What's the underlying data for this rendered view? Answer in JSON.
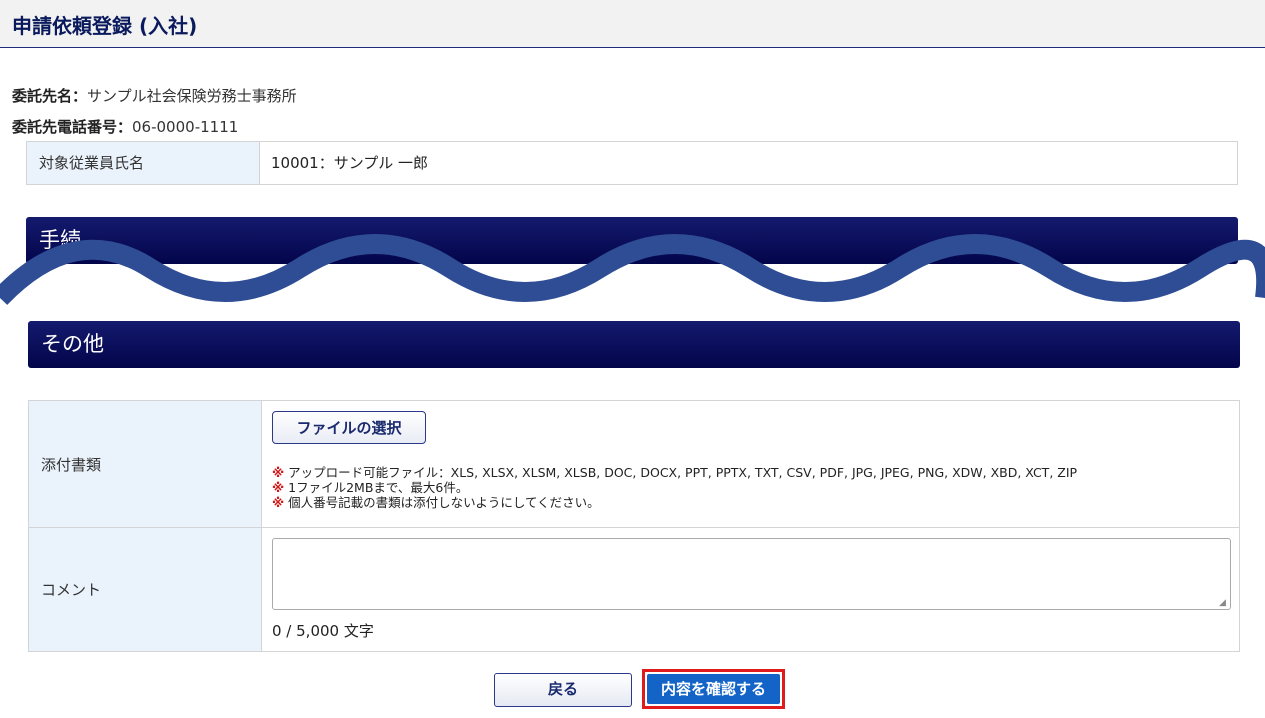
{
  "page": {
    "title": "申請依頼登録 (入社)"
  },
  "contractor": {
    "name_label": "委託先名：",
    "name_value": "サンプル社会保険労務士事務所",
    "phone_label": "委託先電話番号：",
    "phone_value": "06-0000-1111"
  },
  "employee": {
    "label": "対象従業員氏名",
    "value": "10001：サンプル 一郎"
  },
  "sections": {
    "procedure": "手続",
    "other": "その他"
  },
  "attachments": {
    "label": "添付書類",
    "file_button": "ファイルの選択",
    "mark": "※",
    "notes": [
      "アップロード可能ファイル：XLS, XLSX, XLSM, XLSB, DOC, DOCX, PPT, PPTX, TXT, CSV, PDF, JPG, JPEG, PNG, XDW, XBD, XCT, ZIP",
      "1ファイル2MBまで、最大6件。",
      "個人番号記載の書類は添付しないようにしてください。"
    ]
  },
  "comment": {
    "label": "コメント",
    "value": "",
    "counter": "0 / 5,000 文字"
  },
  "actions": {
    "back": "戻る",
    "confirm": "内容を確認する"
  },
  "colors": {
    "section_bar": "#0b0f5e",
    "wave": "#2e4d94",
    "confirm": "#1464c8",
    "highlight": "#e01b1b"
  }
}
